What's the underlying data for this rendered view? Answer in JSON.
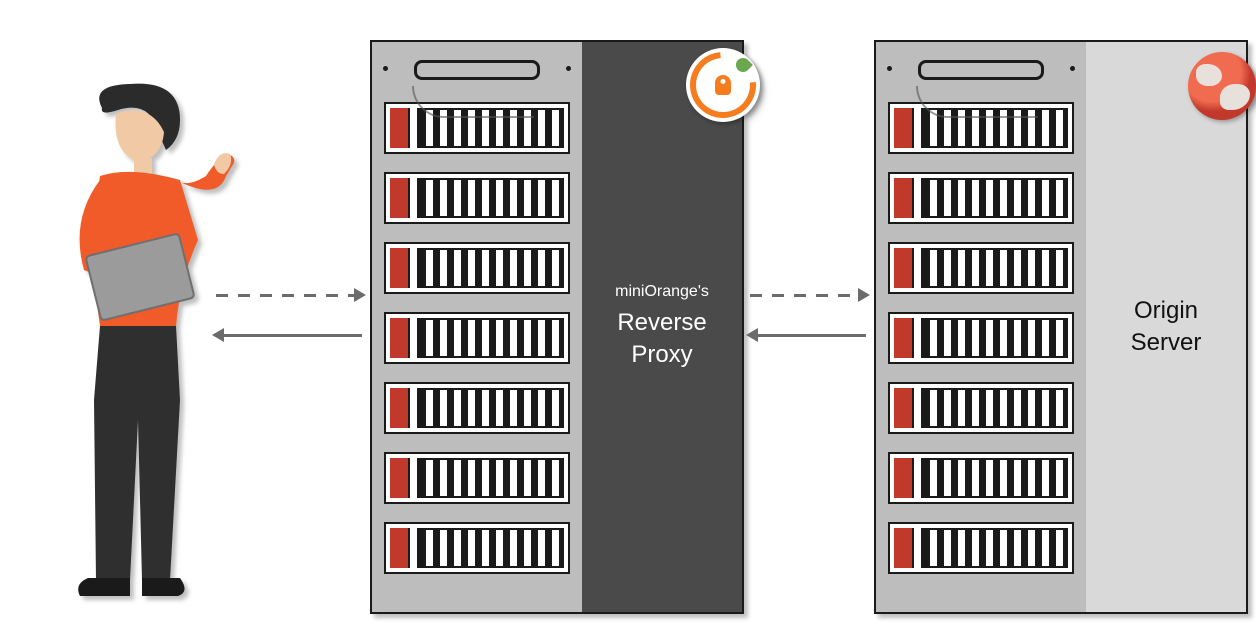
{
  "proxy": {
    "sub": "miniOrange's",
    "line1": "Reverse",
    "line2": "Proxy"
  },
  "origin": {
    "line1": "Origin",
    "line2": "Server"
  },
  "nodes": {
    "user": "user",
    "proxy": "reverse-proxy-server",
    "origin": "origin-server"
  }
}
